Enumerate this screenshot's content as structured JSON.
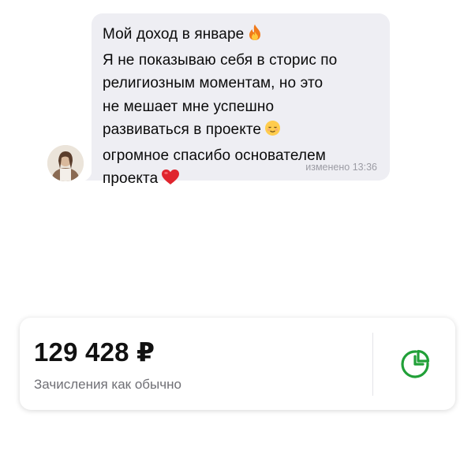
{
  "message": {
    "lines": [
      "Мой доход в январе",
      "Я не показываю себя  в сторис по",
      "религиозным моментам, но это",
      "не мешает мне успешно",
      "развиваться в проекте",
      "огромное спасибо основателем",
      "проекта"
    ],
    "emojis": [
      "fire-emoji",
      "relieved-face-emoji",
      "red-heart-emoji"
    ],
    "edited_label": "изменено",
    "time": "13:36"
  },
  "balance": {
    "amount": "129 428 ₽",
    "caption": "Зачисления как обычно",
    "accent_color": "#21a038",
    "icon": "pie-chart-icon"
  }
}
